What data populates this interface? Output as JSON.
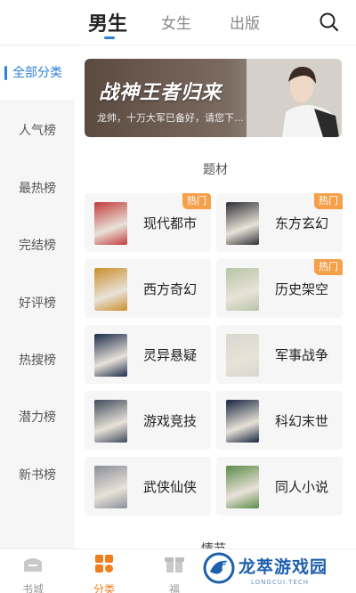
{
  "tabs": [
    {
      "label": "男生",
      "active": true
    },
    {
      "label": "女生",
      "active": false
    },
    {
      "label": "出版",
      "active": false
    }
  ],
  "sidebar": {
    "items": [
      {
        "label": "全部分类",
        "active": true
      },
      {
        "label": "人气榜"
      },
      {
        "label": "最热榜"
      },
      {
        "label": "完结榜"
      },
      {
        "label": "好评榜"
      },
      {
        "label": "热搜榜"
      },
      {
        "label": "潜力榜"
      },
      {
        "label": "新书榜"
      }
    ]
  },
  "banner": {
    "title": "战神王者归来",
    "subtitle": "龙帅，十万大军已备好，请您下..."
  },
  "section": {
    "title": "题材",
    "next_title_partial": "情节"
  },
  "genres": [
    {
      "label": "现代都市",
      "badge": "热门",
      "cover_color": "#c23b3b"
    },
    {
      "label": "东方玄幻",
      "badge": "热门",
      "cover_color": "#2f2f35"
    },
    {
      "label": "西方奇幻",
      "badge": "",
      "cover_color": "#c98f2c"
    },
    {
      "label": "历史架空",
      "badge": "热门",
      "cover_color": "#b7c4a6"
    },
    {
      "label": "灵异悬疑",
      "badge": "",
      "cover_color": "#1d2c4a"
    },
    {
      "label": "军事战争",
      "badge": "",
      "cover_color": "#d9d6d0"
    },
    {
      "label": "游戏竞技",
      "badge": "",
      "cover_color": "#3f4a5c"
    },
    {
      "label": "科幻末世",
      "badge": "",
      "cover_color": "#17253f"
    },
    {
      "label": "武侠仙侠",
      "badge": "",
      "cover_color": "#8a8f99"
    },
    {
      "label": "同人小说",
      "badge": "",
      "cover_color": "#5c8a4a"
    }
  ],
  "bottom_nav": [
    {
      "label": "书城",
      "icon": "bookstore-icon"
    },
    {
      "label": "分类",
      "icon": "category-icon",
      "active": true
    },
    {
      "label": "福",
      "icon": "welfare-icon"
    }
  ],
  "watermark": {
    "text": "龙萃游戏园",
    "sub": "LONGCUI.TECH"
  },
  "colors": {
    "accent": "#2d82d6",
    "hot_badge": "#f5a04b",
    "nav_active": "#f07e1f"
  }
}
